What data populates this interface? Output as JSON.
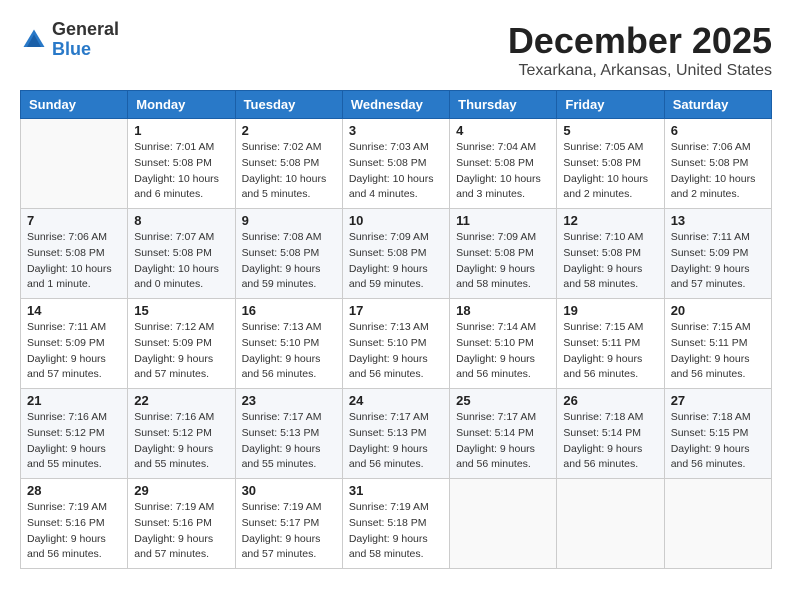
{
  "logo": {
    "general": "General",
    "blue": "Blue"
  },
  "header": {
    "month": "December 2025",
    "location": "Texarkana, Arkansas, United States"
  },
  "weekdays": [
    "Sunday",
    "Monday",
    "Tuesday",
    "Wednesday",
    "Thursday",
    "Friday",
    "Saturday"
  ],
  "weeks": [
    [
      {
        "day": "",
        "detail": ""
      },
      {
        "day": "1",
        "detail": "Sunrise: 7:01 AM\nSunset: 5:08 PM\nDaylight: 10 hours\nand 6 minutes."
      },
      {
        "day": "2",
        "detail": "Sunrise: 7:02 AM\nSunset: 5:08 PM\nDaylight: 10 hours\nand 5 minutes."
      },
      {
        "day": "3",
        "detail": "Sunrise: 7:03 AM\nSunset: 5:08 PM\nDaylight: 10 hours\nand 4 minutes."
      },
      {
        "day": "4",
        "detail": "Sunrise: 7:04 AM\nSunset: 5:08 PM\nDaylight: 10 hours\nand 3 minutes."
      },
      {
        "day": "5",
        "detail": "Sunrise: 7:05 AM\nSunset: 5:08 PM\nDaylight: 10 hours\nand 2 minutes."
      },
      {
        "day": "6",
        "detail": "Sunrise: 7:06 AM\nSunset: 5:08 PM\nDaylight: 10 hours\nand 2 minutes."
      }
    ],
    [
      {
        "day": "7",
        "detail": "Sunrise: 7:06 AM\nSunset: 5:08 PM\nDaylight: 10 hours\nand 1 minute."
      },
      {
        "day": "8",
        "detail": "Sunrise: 7:07 AM\nSunset: 5:08 PM\nDaylight: 10 hours\nand 0 minutes."
      },
      {
        "day": "9",
        "detail": "Sunrise: 7:08 AM\nSunset: 5:08 PM\nDaylight: 9 hours\nand 59 minutes."
      },
      {
        "day": "10",
        "detail": "Sunrise: 7:09 AM\nSunset: 5:08 PM\nDaylight: 9 hours\nand 59 minutes."
      },
      {
        "day": "11",
        "detail": "Sunrise: 7:09 AM\nSunset: 5:08 PM\nDaylight: 9 hours\nand 58 minutes."
      },
      {
        "day": "12",
        "detail": "Sunrise: 7:10 AM\nSunset: 5:08 PM\nDaylight: 9 hours\nand 58 minutes."
      },
      {
        "day": "13",
        "detail": "Sunrise: 7:11 AM\nSunset: 5:09 PM\nDaylight: 9 hours\nand 57 minutes."
      }
    ],
    [
      {
        "day": "14",
        "detail": "Sunrise: 7:11 AM\nSunset: 5:09 PM\nDaylight: 9 hours\nand 57 minutes."
      },
      {
        "day": "15",
        "detail": "Sunrise: 7:12 AM\nSunset: 5:09 PM\nDaylight: 9 hours\nand 57 minutes."
      },
      {
        "day": "16",
        "detail": "Sunrise: 7:13 AM\nSunset: 5:10 PM\nDaylight: 9 hours\nand 56 minutes."
      },
      {
        "day": "17",
        "detail": "Sunrise: 7:13 AM\nSunset: 5:10 PM\nDaylight: 9 hours\nand 56 minutes."
      },
      {
        "day": "18",
        "detail": "Sunrise: 7:14 AM\nSunset: 5:10 PM\nDaylight: 9 hours\nand 56 minutes."
      },
      {
        "day": "19",
        "detail": "Sunrise: 7:15 AM\nSunset: 5:11 PM\nDaylight: 9 hours\nand 56 minutes."
      },
      {
        "day": "20",
        "detail": "Sunrise: 7:15 AM\nSunset: 5:11 PM\nDaylight: 9 hours\nand 56 minutes."
      }
    ],
    [
      {
        "day": "21",
        "detail": "Sunrise: 7:16 AM\nSunset: 5:12 PM\nDaylight: 9 hours\nand 55 minutes."
      },
      {
        "day": "22",
        "detail": "Sunrise: 7:16 AM\nSunset: 5:12 PM\nDaylight: 9 hours\nand 55 minutes."
      },
      {
        "day": "23",
        "detail": "Sunrise: 7:17 AM\nSunset: 5:13 PM\nDaylight: 9 hours\nand 55 minutes."
      },
      {
        "day": "24",
        "detail": "Sunrise: 7:17 AM\nSunset: 5:13 PM\nDaylight: 9 hours\nand 56 minutes."
      },
      {
        "day": "25",
        "detail": "Sunrise: 7:17 AM\nSunset: 5:14 PM\nDaylight: 9 hours\nand 56 minutes."
      },
      {
        "day": "26",
        "detail": "Sunrise: 7:18 AM\nSunset: 5:14 PM\nDaylight: 9 hours\nand 56 minutes."
      },
      {
        "day": "27",
        "detail": "Sunrise: 7:18 AM\nSunset: 5:15 PM\nDaylight: 9 hours\nand 56 minutes."
      }
    ],
    [
      {
        "day": "28",
        "detail": "Sunrise: 7:19 AM\nSunset: 5:16 PM\nDaylight: 9 hours\nand 56 minutes."
      },
      {
        "day": "29",
        "detail": "Sunrise: 7:19 AM\nSunset: 5:16 PM\nDaylight: 9 hours\nand 57 minutes."
      },
      {
        "day": "30",
        "detail": "Sunrise: 7:19 AM\nSunset: 5:17 PM\nDaylight: 9 hours\nand 57 minutes."
      },
      {
        "day": "31",
        "detail": "Sunrise: 7:19 AM\nSunset: 5:18 PM\nDaylight: 9 hours\nand 58 minutes."
      },
      {
        "day": "",
        "detail": ""
      },
      {
        "day": "",
        "detail": ""
      },
      {
        "day": "",
        "detail": ""
      }
    ]
  ]
}
